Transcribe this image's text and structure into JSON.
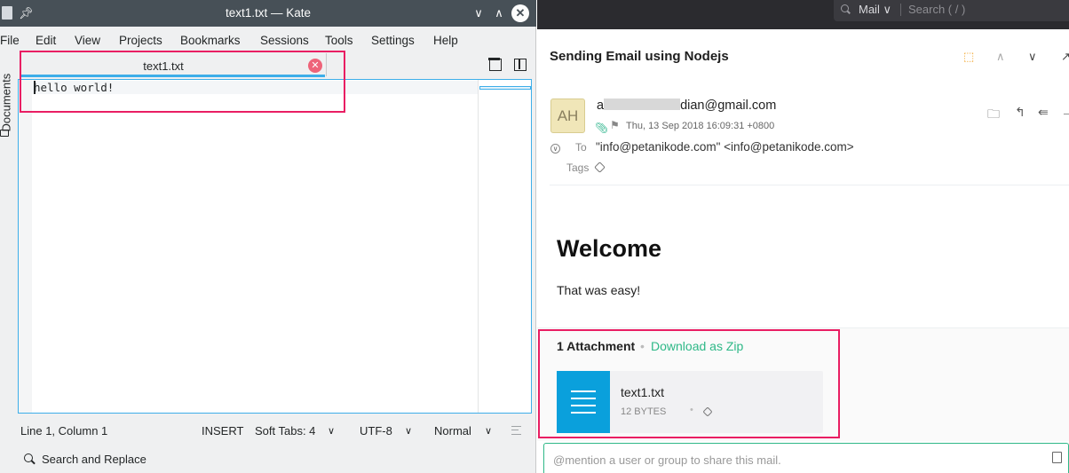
{
  "kate": {
    "window_title": "text1.txt — Kate",
    "menu": [
      "File",
      "Edit",
      "View",
      "Projects",
      "Bookmarks",
      "Sessions",
      "Tools",
      "Settings",
      "Help"
    ],
    "side_tab": "Documents",
    "tab_label": "text1.txt",
    "editor_text": "hello world!",
    "status": {
      "position": "Line 1, Column 1",
      "mode": "INSERT",
      "indent": "Soft Tabs: 4",
      "encoding": "UTF-8",
      "highlight": "Normal"
    },
    "search_replace": "Search and Replace",
    "icons": {
      "pin": "pin-icon",
      "min": "chevron-down-icon",
      "max": "chevron-up-icon",
      "close": "close-icon"
    }
  },
  "mail": {
    "search": {
      "scope": "Mail",
      "placeholder": "Search ( / )"
    },
    "subject": "Sending Email using Nodejs",
    "avatar_initials": "AH",
    "sender_visible_prefix": "a",
    "sender_visible_suffix": "dian@gmail.com",
    "date": "Thu, 13 Sep 2018 16:09:31 +0800",
    "to_label": "To",
    "to_value": "\"info@petanikode.com\" <info@petanikode.com>",
    "tags_label": "Tags",
    "body_heading": "Welcome",
    "body_text": "That was easy!",
    "attachments": {
      "count_label": "1 Attachment",
      "download_label": "Download as Zip",
      "file_name": "text1.txt",
      "file_size": "12 BYTES"
    },
    "mention_placeholder": "@mention a user or group to share this mail."
  },
  "colors": {
    "highlight_box": "#e91e63",
    "kate_accent": "#3daee9",
    "mail_accent": "#2eb887",
    "attachment_thumb": "#0aa0dc"
  }
}
